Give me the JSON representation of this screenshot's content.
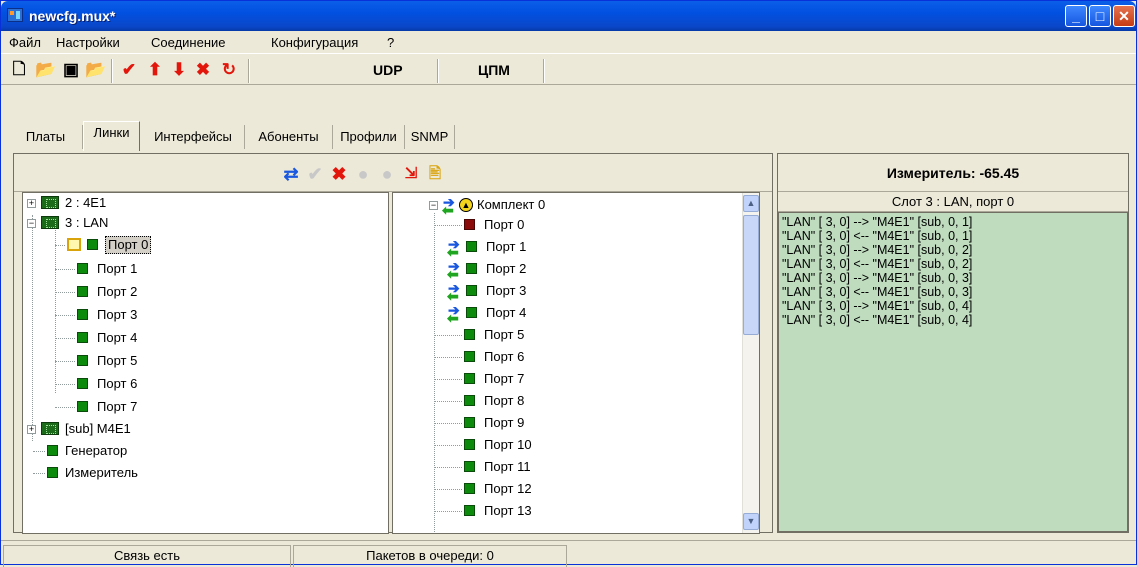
{
  "window": {
    "title": "newcfg.mux*"
  },
  "menu": [
    "Файл",
    "Настройки",
    "Соединение",
    "Конфигурация",
    "?"
  ],
  "toolbar": {
    "udp_label": "UDP",
    "cpm_label": "ЦПМ"
  },
  "tabs": [
    "Платы",
    "Линки",
    "Интерфейсы",
    "Абоненты",
    "Профили",
    "SNMP"
  ],
  "active_tab": "Линки",
  "tree_left": {
    "items": [
      "2 : 4E1",
      "3 : LAN",
      "Порт 0",
      "Порт 1",
      "Порт 2",
      "Порт 3",
      "Порт 4",
      "Порт 5",
      "Порт 6",
      "Порт 7",
      "[sub] M4E1",
      "Генератор",
      "Измеритель"
    ]
  },
  "tree_right": {
    "root": "Комплект 0",
    "ports": [
      "Порт 0",
      "Порт 1",
      "Порт 2",
      "Порт 3",
      "Порт 4",
      "Порт 5",
      "Порт 6",
      "Порт 7",
      "Порт 8",
      "Порт 9",
      "Порт 10",
      "Порт 11",
      "Порт 12",
      "Порт 13"
    ]
  },
  "meter": {
    "title": "Измеритель: -65.45",
    "slot": "Слот 3 : LAN, порт 0",
    "log": [
      "\"LAN\" [ 3,  0] -->  \"M4E1\" [sub, 0,  1]",
      "\"LAN\" [ 3,  0] <--  \"M4E1\" [sub, 0,  1]",
      "\"LAN\" [ 3,  0] -->  \"M4E1\" [sub, 0,  2]",
      "\"LAN\" [ 3,  0] <--  \"M4E1\" [sub, 0,  2]",
      "\"LAN\" [ 3,  0] -->  \"M4E1\" [sub, 0,  3]",
      "\"LAN\" [ 3,  0] <--  \"M4E1\" [sub, 0,  3]",
      "\"LAN\" [ 3,  0] -->  \"M4E1\" [sub, 0,  4]",
      "\"LAN\" [ 3,  0] <--  \"M4E1\" [sub, 0,  4]"
    ]
  },
  "status": {
    "connection": "Связь есть",
    "queue": "Пакетов в очереди: 0"
  },
  "colors": {
    "titlebar": "#0250e0",
    "log_bg": "#bfdcbf",
    "port_green": "#0b8a0b",
    "port_red": "#8b0a0a"
  }
}
